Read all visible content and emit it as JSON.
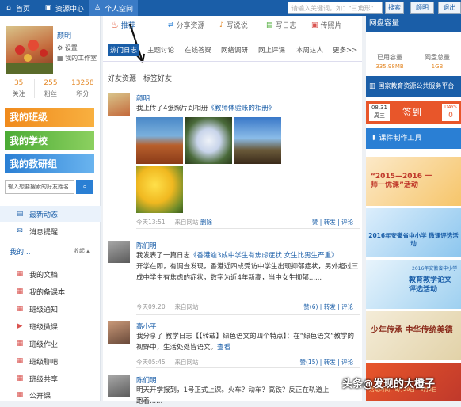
{
  "topbar": {
    "home": "首页",
    "resource": "资源中心",
    "space": "个人空间",
    "search_placeholder": "请输入关键词，如：\"三角形\"",
    "search_btn": "搜索",
    "user": "颜明",
    "logout": "退出"
  },
  "profile": {
    "name": "颜明",
    "settings": "设置",
    "workshop": "我的工作室",
    "stats": [
      {
        "value": "35",
        "label": "关注"
      },
      {
        "value": "255",
        "label": "粉丝"
      },
      {
        "value": "13258",
        "label": "积分"
      }
    ]
  },
  "groups": {
    "class": "我的班级",
    "school": "我的学校",
    "research": "我的教研组"
  },
  "friend_search": {
    "placeholder": "输入想要搜索的好友姓名"
  },
  "menu_top": [
    {
      "label": "最新动态"
    },
    {
      "label": "消息提醒"
    }
  ],
  "menu_section": {
    "title": "我的...",
    "collapse": "收起"
  },
  "menu_items": [
    {
      "label": "我的文档"
    },
    {
      "label": "我的备课本"
    },
    {
      "label": "班级通知"
    },
    {
      "label": "班级微课"
    },
    {
      "label": "班级作业"
    },
    {
      "label": "班级聊吧"
    },
    {
      "label": "班级共享"
    },
    {
      "label": "公开课"
    }
  ],
  "main_tabs": [
    {
      "label": "推荐"
    },
    {
      "label": "分享资源"
    },
    {
      "label": "写说说"
    },
    {
      "label": "写日志"
    },
    {
      "label": "传照片"
    }
  ],
  "sub_tabs": [
    {
      "label": "热门日志"
    },
    {
      "label": "主题讨论"
    },
    {
      "label": "在线答疑"
    },
    {
      "label": "网络调研"
    },
    {
      "label": "网上评课"
    },
    {
      "label": "本周达人"
    },
    {
      "label": "更多>>"
    }
  ],
  "feed_tabs": [
    {
      "label": "好友资源"
    },
    {
      "label": "标签好友"
    }
  ],
  "feed": [
    {
      "name": "颜明",
      "text_pre": "我上传了4张照片到相册",
      "text_link": "《教师体验账的相册》",
      "body": "",
      "time": "今天13:51",
      "source": "来自网站",
      "delete": "删除",
      "actions": "赞 | 转发 | 评论"
    },
    {
      "name": "陈们明",
      "text_pre": "我发表了一篇日志",
      "text_link": "《香港逾3成中学生有焦虑症状 女生比男生严重》",
      "body": "开学在即，有调查发现，香港近四成受访中学生出现抑郁症状，另外超过三成中学生有焦虑的症状，数字为近4年新高，当中女生抑郁......",
      "time": "今天09:20",
      "source": "来自网站",
      "delete": "",
      "actions": "赞(6) | 转发 | 评论"
    },
    {
      "name": "高小平",
      "text_pre": "我分享了 教学日志【【转载】绿色语文的四个特点】：在“绿色语文”教学的视野中，生活处处皆语文。",
      "text_link": "查看",
      "body": "",
      "time": "今天05:45",
      "source": "来自网站",
      "delete": "",
      "actions": "赞(15) | 转发 | 评论"
    },
    {
      "name": "陈们明",
      "text_pre": "明天开学报到，1号正式上课。火车？动车？高铁？反正在轨道上跑着......",
      "text_link": "",
      "body": "",
      "time": "",
      "source": "",
      "delete": "",
      "actions": ""
    }
  ],
  "right": {
    "disk_title": "网盘容量",
    "disk_used_label": "已用容量",
    "disk_used_value": "335.98MB",
    "disk_total_label": "网盘总量",
    "disk_total_value": "1GB",
    "edu_platform": "国家教育资源公共服务平台",
    "signin_date": "08.31",
    "signin_weekday": "周三",
    "signin": "签到",
    "days_label": "DAYS",
    "days_value": "0",
    "courseware": "课件制作工具",
    "banner1": "“2015—2016 一师一优课”活动",
    "banner2": "2016年安徽省中小学 微课评选活动",
    "banner3_top": "2016年安徽省中小学",
    "banner3": "教育教学论文 评选活动",
    "banner4": "少年传承 中华传统美德",
    "banner5": "活动时间：8月29日—8月2日",
    "watermark": "头条@发现的大橙子"
  },
  "colors": {
    "brand": "#1a5ea8",
    "orange": "#e48a2a",
    "green": "#6ab344"
  }
}
